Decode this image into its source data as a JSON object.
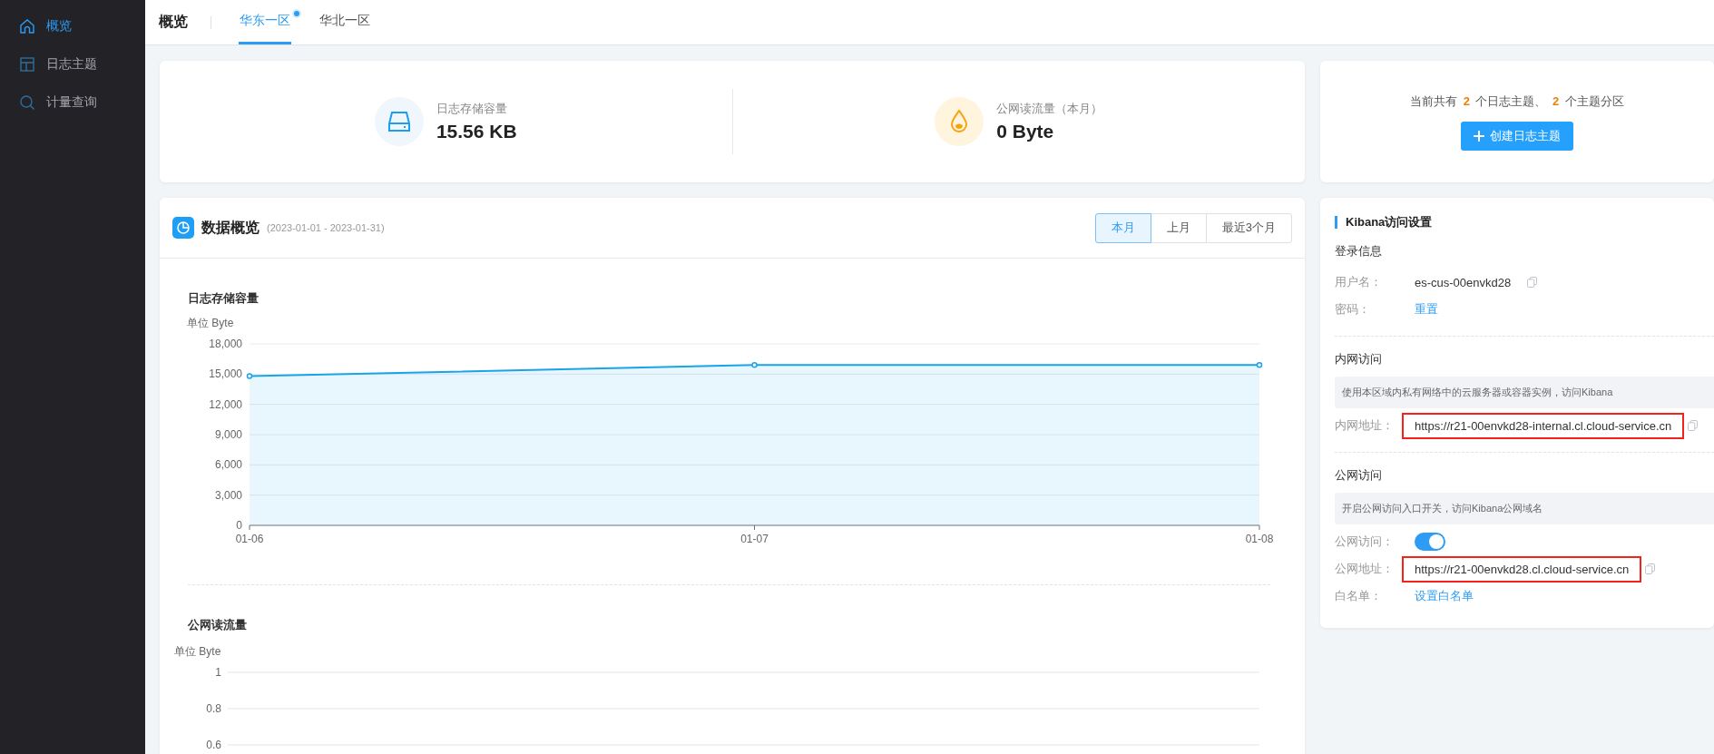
{
  "sidebar": {
    "items": [
      {
        "kind": "home",
        "label": "概览",
        "selected": true
      },
      {
        "kind": "layout",
        "label": "日志主题",
        "selected": false
      },
      {
        "kind": "search",
        "label": "计量查询",
        "selected": false
      }
    ]
  },
  "header": {
    "title": "概览",
    "tabs": [
      {
        "label": "华东一区",
        "selected": true,
        "dot": true
      },
      {
        "label": "华北一区",
        "selected": false,
        "dot": false
      }
    ]
  },
  "stats": [
    {
      "kind": "storage",
      "label": "日志存储容量",
      "value": "15.56 KB"
    },
    {
      "kind": "traffic",
      "label": "公网读流量（本月）",
      "value": "0 Byte"
    }
  ],
  "summary": {
    "text": "当前共有 **2** 个日志主题、 **2** 个主题分区",
    "button": "创建日志主题"
  },
  "data_overview": {
    "title": "数据概览",
    "range": "(2023-01-01 - 2023-01-31)",
    "periods": [
      {
        "label": "本月",
        "selected": true
      },
      {
        "label": "上月",
        "selected": false
      },
      {
        "label": "最近3个月",
        "selected": false
      }
    ],
    "charts": [
      {
        "chart_data": {
          "type": "area",
          "title": "日志存储容量",
          "ylabel": "单位 Byte",
          "categories": [
            "01-06",
            "01-07",
            "01-08"
          ],
          "ylim": [
            0,
            18000
          ],
          "yticks": [
            {
              "value": 0,
              "label": "0"
            },
            {
              "value": 3000,
              "label": "3,000"
            },
            {
              "value": 6000,
              "label": "6,000"
            },
            {
              "value": 9000,
              "label": "9,000"
            },
            {
              "value": 12000,
              "label": "12,000"
            },
            {
              "value": 15000,
              "label": "15,000"
            },
            {
              "value": 18000,
              "label": "18,000"
            }
          ],
          "grid": true,
          "series": [
            {
              "color": "#1aa3e8",
              "values": [
                14800,
                15900,
                15900
              ]
            }
          ]
        }
      },
      {
        "empty_chart": {
          "title": "公网读流量",
          "unit": "单位 Byte",
          "tick_labels": [
            "1",
            "0.8",
            "0.6"
          ]
        }
      }
    ]
  },
  "kibana": {
    "title": "Kibana访问设置",
    "sections": [
      {
        "heading": "登录信息",
        "rows": [
          {
            "kind": "text",
            "label": "用户名：",
            "value": "es-cus-00envkd28",
            "copy": true,
            "highlighted": false
          },
          {
            "kind": "link",
            "label": "密码：",
            "value": "重置"
          }
        ]
      },
      {
        "heading": "内网访问",
        "note": "使用本区域内私有网络中的云服务器或容器实例，访问Kibana",
        "rows": [
          {
            "kind": "text",
            "label": "内网地址：",
            "value": "https://r21-00envkd28-internal.cl.cloud-service.cn",
            "copy": true,
            "highlighted": true
          }
        ]
      },
      {
        "heading": "公网访问",
        "note": "开启公网访问入口开关，访问Kibana公网域名",
        "rows": [
          {
            "kind": "switch",
            "label": "公网访问：",
            "on": true
          },
          {
            "kind": "text",
            "label": "公网地址：",
            "value": "https://r21-00envkd28.cl.cloud-service.cn",
            "copy": true,
            "highlighted": true
          },
          {
            "kind": "link",
            "label": "白名单：",
            "value": "设置白名单"
          }
        ]
      }
    ]
  }
}
